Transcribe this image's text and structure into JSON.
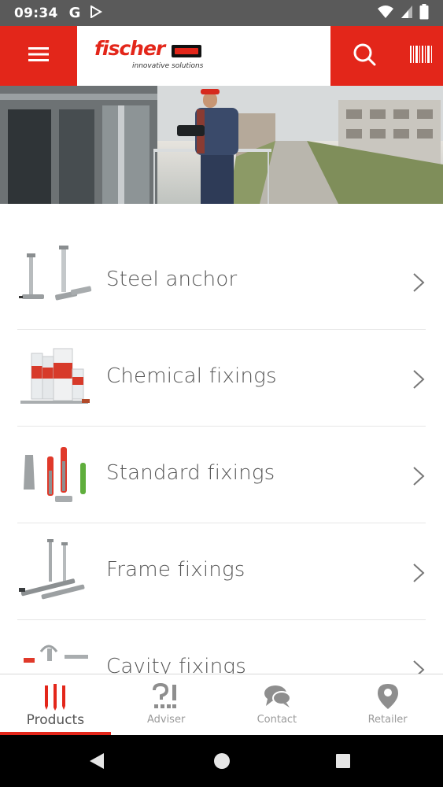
{
  "status_bar": {
    "time": "09:34",
    "google_letter": "G",
    "icons": [
      "google-icon",
      "play-store-icon",
      "wifi-icon",
      "signal-icon",
      "battery-icon"
    ]
  },
  "header": {
    "brand_name": "fischer",
    "tagline": "innovative solutions",
    "menu_icon": "hamburger-menu-icon",
    "search_icon": "search-icon",
    "barcode_icon": "barcode-scanner-icon",
    "brand_color": "#e3261a"
  },
  "categories": [
    {
      "label": "Steel anchor",
      "thumb": "steel-anchor-image"
    },
    {
      "label": "Chemical fixings",
      "thumb": "chemical-fixings-image"
    },
    {
      "label": "Standard fixings",
      "thumb": "standard-fixings-image"
    },
    {
      "label": "Frame fixings",
      "thumb": "frame-fixings-image"
    },
    {
      "label": "Cavity fixings",
      "thumb": "cavity-fixings-image"
    }
  ],
  "bottom_nav": {
    "items": [
      {
        "label": "Products",
        "icon": "products-icon",
        "active": true
      },
      {
        "label": "Adviser",
        "icon": "adviser-icon",
        "active": false
      },
      {
        "label": "Contact",
        "icon": "contact-chat-icon",
        "active": false
      },
      {
        "label": "Retailer",
        "icon": "location-pin-icon",
        "active": false
      }
    ]
  }
}
